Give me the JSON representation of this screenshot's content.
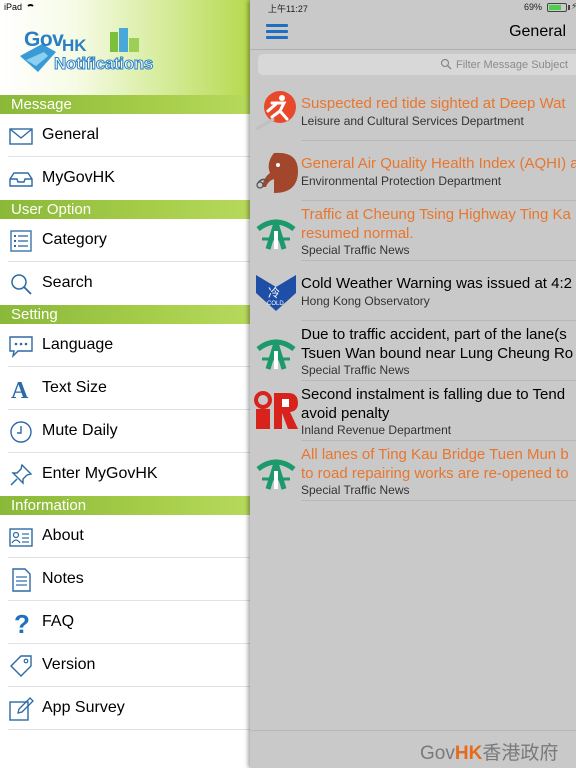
{
  "status": {
    "device": "iPad",
    "time": "上午11:27",
    "battery": "69%"
  },
  "logo": {
    "part1": "Gov",
    "part2": "HK",
    "part3": "Notifications"
  },
  "drawer": {
    "sections": [
      {
        "title": "Message",
        "items": [
          {
            "label": "General",
            "icon": "envelope-icon"
          },
          {
            "label": "MyGovHK",
            "icon": "inbox-tray-icon"
          }
        ]
      },
      {
        "title": "User Option",
        "items": [
          {
            "label": "Category",
            "icon": "list-icon"
          },
          {
            "label": "Search",
            "icon": "magnifier-icon"
          }
        ]
      },
      {
        "title": "Setting",
        "items": [
          {
            "label": "Language",
            "icon": "speech-bubble-icon"
          },
          {
            "label": "Text Size",
            "icon": "letter-a-icon"
          },
          {
            "label": "Mute Daily",
            "icon": "clock-icon"
          },
          {
            "label": "Enter MyGovHK",
            "icon": "pushpin-icon"
          }
        ]
      },
      {
        "title": "Information",
        "items": [
          {
            "label": "About",
            "icon": "id-card-icon"
          },
          {
            "label": "Notes",
            "icon": "document-icon"
          },
          {
            "label": "FAQ",
            "icon": "question-mark-icon"
          },
          {
            "label": "Version",
            "icon": "tag-icon"
          },
          {
            "label": "App Survey",
            "icon": "edit-icon"
          }
        ]
      }
    ]
  },
  "main": {
    "title": "General",
    "search_placeholder": "Filter Message Subject",
    "messages": [
      {
        "title": "Suspected red tide sighted at Deep Wat",
        "dept": "Leisure and Cultural Services Department",
        "unread": true,
        "logo": "lcsd-runner-logo"
      },
      {
        "title": "General Air Quality Health Index (AQHI) a",
        "dept": "Environmental Protection Department",
        "unread": true,
        "logo": "epd-elephant-logo"
      },
      {
        "title": "Traffic at Cheung Tsing Highway Ting Ka",
        "title2": "resumed normal.",
        "dept": "Special Traffic News",
        "unread": true,
        "logo": "td-road-logo"
      },
      {
        "title": "Cold Weather Warning was issued at 4:2",
        "dept": "Hong Kong Observatory",
        "unread": false,
        "logo": "cold-warning-logo"
      },
      {
        "title": "Due to traffic accident, part of the lane(s",
        "title2": "Tsuen Wan bound near Lung Cheung Ro",
        "dept": "Special Traffic News",
        "unread": false,
        "logo": "td-road-logo"
      },
      {
        "title": "Second instalment is falling due to Tend",
        "title2": "avoid penalty",
        "dept": "Inland Revenue Department",
        "unread": false,
        "logo": "ird-logo"
      },
      {
        "title": "All lanes of Ting Kau Bridge Tuen Mun b",
        "title2": "to road repairing works are re-opened to",
        "dept": "Special Traffic News",
        "unread": true,
        "logo": "td-road-logo"
      }
    ],
    "footer": {
      "gov": "Gov",
      "hk": "HK",
      "chinese": "香港政府"
    }
  },
  "colors": {
    "accent_green": "#9ac343",
    "unread_orange": "#e8762e",
    "menu_blue": "#1e6fc0"
  }
}
